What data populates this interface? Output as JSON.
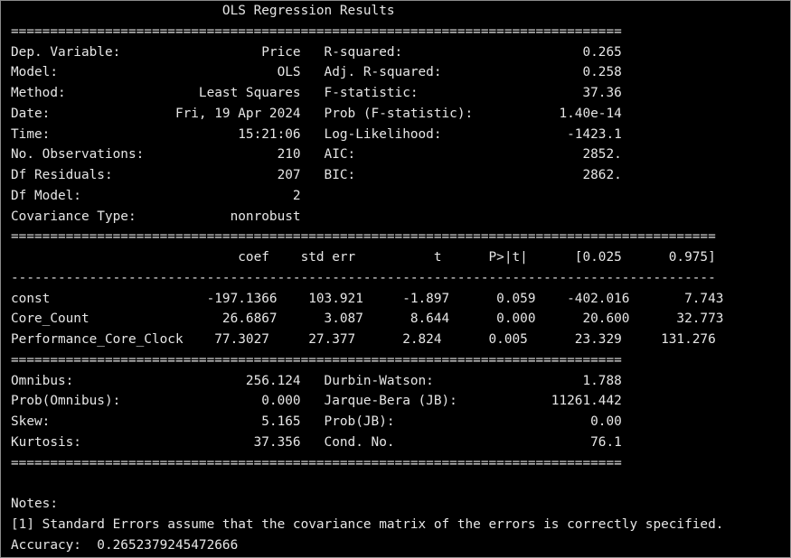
{
  "console": {
    "lines": [
      "                           OLS Regression Results                            ",
      "==============================================================================",
      "Dep. Variable:                  Price   R-squared:                       0.265",
      "Model:                            OLS   Adj. R-squared:                  0.258",
      "Method:                 Least Squares   F-statistic:                     37.36",
      "Date:                Fri, 19 Apr 2024   Prob (F-statistic):           1.40e-14",
      "Time:                        15:21:06   Log-Likelihood:                -1423.1",
      "No. Observations:                 210   AIC:                             2852.",
      "Df Residuals:                     207   BIC:                             2862.",
      "Df Model:                           2                                         ",
      "Covariance Type:            nonrobust                                         ",
      "==========================================================================================",
      "                             coef    std err          t      P>|t|      [0.025      0.975]",
      "------------------------------------------------------------------------------------------",
      "const                    -197.1366    103.921     -1.897      0.059    -402.016       7.743",
      "Core_Count                 26.6867      3.087      8.644      0.000      20.600      32.773",
      "Performance_Core_Clock    77.3027     27.377      2.824      0.005      23.329     131.276",
      "==============================================================================",
      "Omnibus:                      256.124   Durbin-Watson:                   1.788",
      "Prob(Omnibus):                  0.000   Jarque-Bera (JB):            11261.442",
      "Skew:                           5.165   Prob(JB):                         0.00",
      "Kurtosis:                      37.356   Cond. No.                         76.1",
      "==============================================================================",
      "",
      "Notes:",
      "[1] Standard Errors assume that the covariance matrix of the errors is correctly specified.",
      "Accuracy:  0.2652379245472666"
    ]
  }
}
